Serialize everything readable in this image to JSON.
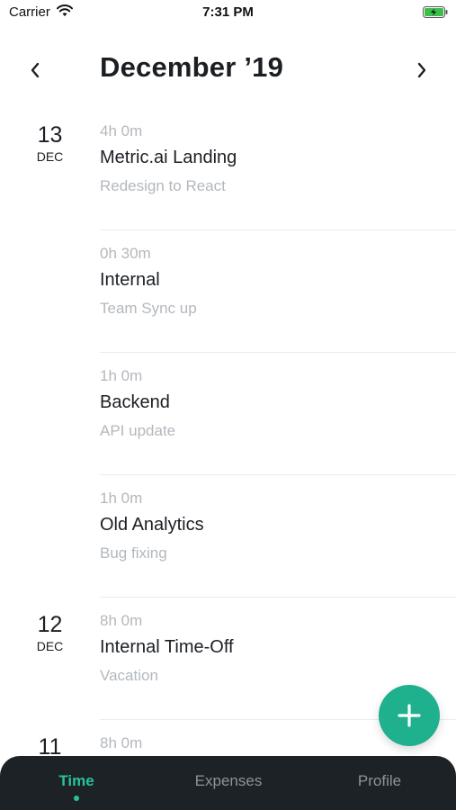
{
  "status_bar": {
    "carrier": "Carrier",
    "time": "7:31 PM",
    "wifi_icon": "wifi-icon",
    "battery_icon": "battery-charging-icon"
  },
  "header": {
    "title": "December ’19",
    "prev_icon": "chevron-left-icon",
    "next_icon": "chevron-right-icon"
  },
  "entries": [
    {
      "day": "13",
      "month": "DEC",
      "duration": "4h 0m",
      "project": "Metric.ai Landing",
      "task": "Redesign to React"
    },
    {
      "day": "",
      "month": "",
      "duration": "0h 30m",
      "project": "Internal",
      "task": "Team Sync up"
    },
    {
      "day": "",
      "month": "",
      "duration": "1h 0m",
      "project": "Backend",
      "task": "API update"
    },
    {
      "day": "",
      "month": "",
      "duration": "1h 0m",
      "project": "Old Analytics",
      "task": "Bug fixing"
    },
    {
      "day": "12",
      "month": "DEC",
      "duration": "8h 0m",
      "project": "Internal Time-Off",
      "task": "Vacation"
    },
    {
      "day": "11",
      "month": "",
      "duration": "8h 0m",
      "project": "",
      "task": ""
    }
  ],
  "fab": {
    "icon": "plus-icon"
  },
  "tab_bar": {
    "tabs": [
      {
        "label": "Time",
        "active": true
      },
      {
        "label": "Expenses",
        "active": false
      },
      {
        "label": "Profile",
        "active": false
      }
    ]
  },
  "colors": {
    "accent": "#26c39a",
    "fab": "#1fb08e",
    "tab_bar_bg": "#1d2227",
    "muted_text": "#b3b8bd"
  }
}
